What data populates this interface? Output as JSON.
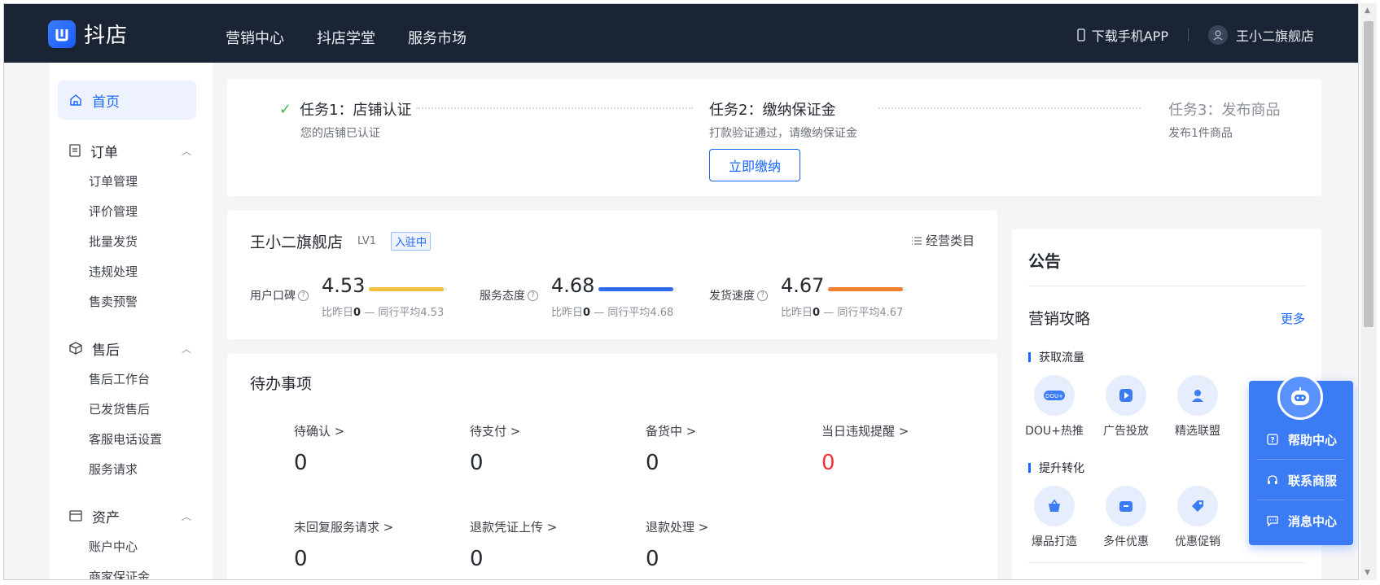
{
  "header": {
    "logo_text": "抖店",
    "nav": [
      "营销中心",
      "抖店学堂",
      "服务市场"
    ],
    "download_app": "下载手机APP",
    "shop_user": "王小二旗舰店"
  },
  "sidebar": {
    "home": "首页",
    "groups": [
      {
        "title": "订单",
        "items": [
          "订单管理",
          "评价管理",
          "批量发货",
          "违规处理",
          "售卖预警"
        ]
      },
      {
        "title": "售后",
        "items": [
          "售后工作台",
          "已发货售后",
          "客服电话设置",
          "服务请求"
        ]
      },
      {
        "title": "资产",
        "items": [
          "账户中心",
          "商家保证金"
        ]
      }
    ]
  },
  "tasks": {
    "items": [
      {
        "title": "任务1：店铺认证",
        "sub": "您的店铺已认证",
        "done": true
      },
      {
        "title": "任务2：缴纳保证金",
        "sub": "打款验证通过，请缴纳保证金",
        "done": false
      },
      {
        "title": "任务3：发布商品",
        "sub": "发布1件商品",
        "done": false
      }
    ],
    "pay_button": "立即缴纳"
  },
  "shop": {
    "name": "王小二旗舰店",
    "level": "LV1",
    "status_badge": "入驻中",
    "category_link": "经营类目",
    "metrics": [
      {
        "label": "用户口碑",
        "value": "4.53",
        "compare_label": "比昨日",
        "compare_value": "0",
        "peer": "同行平均4.53",
        "color": "#f5c040"
      },
      {
        "label": "服务态度",
        "value": "4.68",
        "compare_label": "比昨日",
        "compare_value": "0",
        "peer": "同行平均4.68",
        "color": "#2f6bf0"
      },
      {
        "label": "发货速度",
        "value": "4.67",
        "compare_label": "比昨日",
        "compare_value": "0",
        "peer": "同行平均4.67",
        "color": "#f08030"
      }
    ]
  },
  "todo": {
    "title": "待办事项",
    "items": [
      {
        "label": "待确认 >",
        "value": "0"
      },
      {
        "label": "待支付 >",
        "value": "0"
      },
      {
        "label": "备货中 >",
        "value": "0"
      },
      {
        "label": "当日违规提醒 >",
        "value": "0"
      },
      {
        "label": "未回复服务请求 >",
        "value": "0"
      },
      {
        "label": "退款凭证上传 >",
        "value": "0"
      },
      {
        "label": "退款处理 >",
        "value": "0"
      }
    ]
  },
  "notice": {
    "title": "公告",
    "marketing_title": "营销攻略",
    "more": "更多",
    "sections": [
      {
        "label": "获取流量",
        "tools": [
          "DOU+热推",
          "广告投放",
          "精选联盟"
        ]
      },
      {
        "label": "提升转化",
        "tools": [
          "爆品打造",
          "多件优惠",
          "优惠促销"
        ]
      }
    ]
  },
  "float_panel": {
    "items": [
      "帮助中心",
      "联系商服",
      "消息中心"
    ]
  }
}
